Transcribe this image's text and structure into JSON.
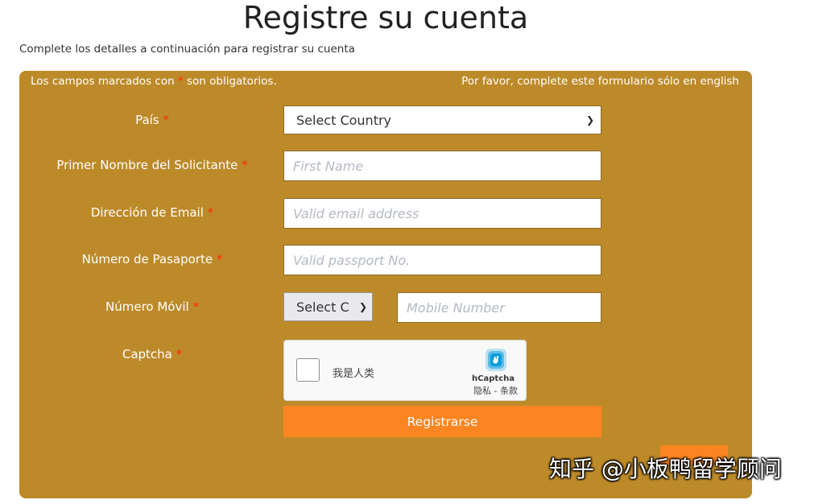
{
  "header": {
    "title": "Registre su cuenta",
    "subtitle": "Complete los detalles a continuación para registrar su cuenta"
  },
  "form": {
    "note_left_prefix": "Los campos marcados con",
    "note_left_suffix": "son obligatorios.",
    "required_mark": "*",
    "note_right": "Por favor, complete este formulario sólo en english",
    "country": {
      "label": "País",
      "value": "Select Country"
    },
    "first_name": {
      "label": "Primer Nombre del Solicitante",
      "placeholder": "First Name"
    },
    "email": {
      "label": "Dirección de Email",
      "placeholder": "Valid email address"
    },
    "passport": {
      "label": "Número de Pasaporte",
      "placeholder": "Valid passport No."
    },
    "mobile": {
      "label": "Número Móvil",
      "code_value": "Select C",
      "placeholder": "Mobile Number"
    },
    "captcha": {
      "label": "Captcha",
      "checkbox_text": "我是人类",
      "brand": "hCaptcha",
      "links": "隐私 - 条款"
    },
    "submit_label": "Registrarse"
  },
  "watermark": {
    "text": "知乎 @小板鸭留学顾问"
  },
  "colors": {
    "panel": "#bd8a2a",
    "button": "#fb8520",
    "required": "#ff2a00"
  }
}
